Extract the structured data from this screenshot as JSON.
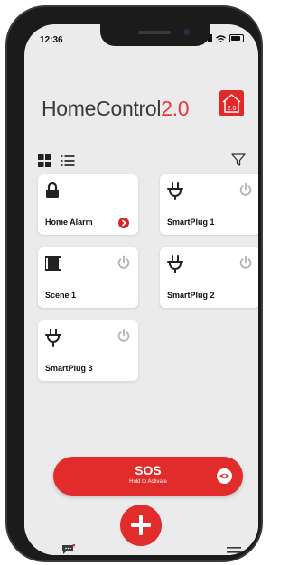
{
  "status_bar": {
    "time": "12:36"
  },
  "header": {
    "app_name_prefix": "HomeControl",
    "app_name_version": "2.0",
    "logo_text": "2.0"
  },
  "colors": {
    "accent": "#e22b2b",
    "background": "#ebebeb",
    "card": "#ffffff"
  },
  "toolbar": {
    "view_grid": "grid-view-icon",
    "view_list": "list-view-icon",
    "filter": "filter-icon"
  },
  "tiles": [
    {
      "label": "Home Alarm",
      "icon": "lock-icon",
      "control": "arrow-right-icon"
    },
    {
      "label": "SmartPlug 1",
      "icon": "plug-icon",
      "control": "power-icon"
    },
    {
      "label": "Scene 1",
      "icon": "scene-icon",
      "control": "power-icon"
    },
    {
      "label": "SmartPlug 2",
      "icon": "plug-icon",
      "control": "power-icon"
    },
    {
      "label": "SmartPlug 3",
      "icon": "plug-icon",
      "control": "power-icon"
    }
  ],
  "sos": {
    "title": "SOS",
    "subtitle": "Hold to Activate"
  },
  "bottom_nav": {
    "left": "chat-icon",
    "center": "add-icon",
    "right": "menu-icon"
  }
}
